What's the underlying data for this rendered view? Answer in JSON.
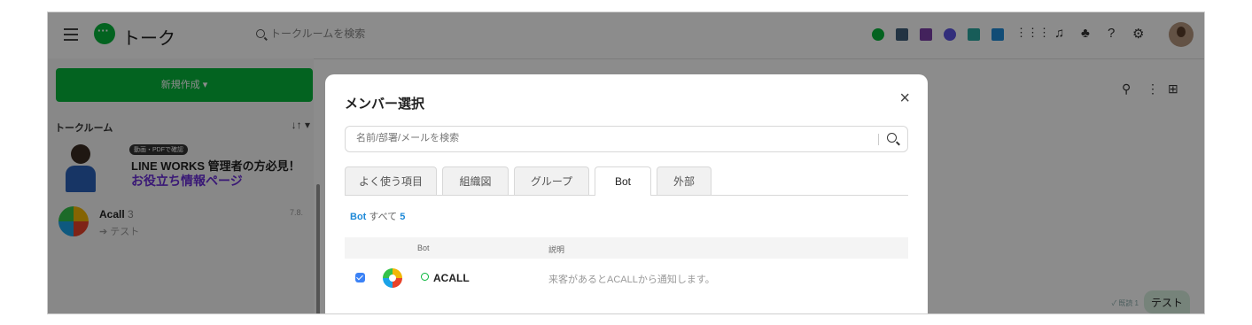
{
  "header": {
    "title": "トーク",
    "search_placeholder": "トークルームを検索",
    "app_colors": [
      "#07b53b",
      "#3f5d7a",
      "#7a3fa8",
      "#5c54e0",
      "#2aa8a0",
      "#1f8ad8"
    ],
    "right_icons": [
      "apps-grid-icon",
      "bell-icon",
      "org-icon",
      "help-icon",
      "settings-icon",
      "avatar"
    ]
  },
  "left": {
    "new_button": "新規作成 ▾",
    "section_label": "トークルーム",
    "sort_icon": "↓↑ ▾",
    "banner": {
      "badge": "動画・PDFで確認",
      "line1": "LINE WORKS 管理者の方必見！",
      "line2": "お役立ち情報ページ"
    },
    "rooms": [
      {
        "name": "Acall",
        "count": "3",
        "date": "7.8.",
        "preview": "➔ テスト"
      }
    ]
  },
  "right": {
    "message": "テスト",
    "read": "✓ 既読 1"
  },
  "modal": {
    "title": "メンバー選択",
    "close": "×",
    "search_placeholder": "名前/部署/メールを検索",
    "tabs": [
      "よく使う項目",
      "組織図",
      "グループ",
      "Bot",
      "外部"
    ],
    "active_tab": "Bot",
    "list_header": {
      "label": "Bot",
      "all": "すべて",
      "count": "5"
    },
    "columns": [
      "Bot",
      "説明"
    ],
    "rows": [
      {
        "name": "ACALL",
        "description": "来客があるとACALLから通知します。",
        "checked": true
      }
    ]
  }
}
